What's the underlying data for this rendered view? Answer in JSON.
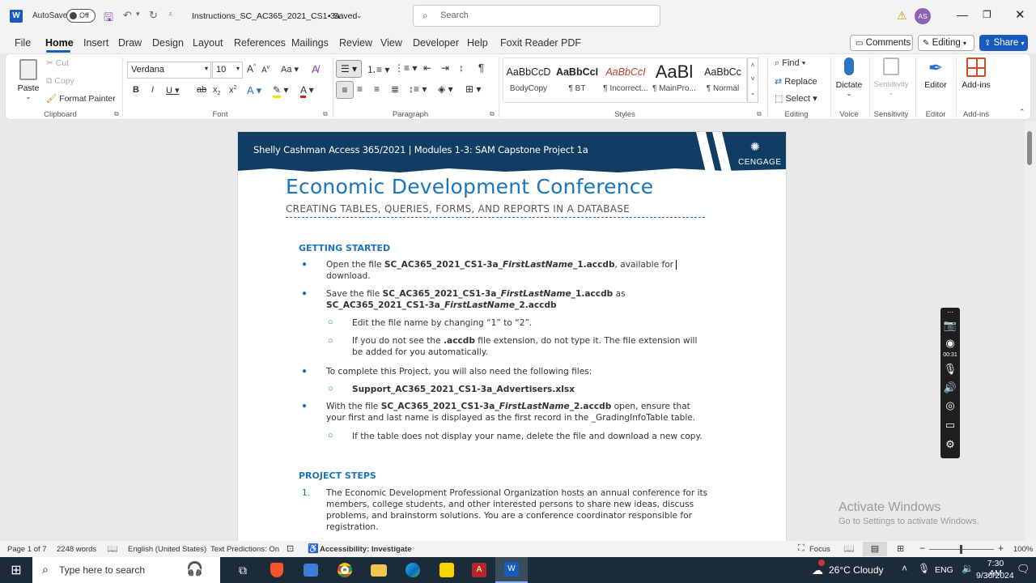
{
  "titlebar": {
    "autosave_label": "AutoSave",
    "autosave_state": "Off",
    "doc_title": "Instructions_SC_AC365_2021_CS1-3a",
    "save_status": "• Saved",
    "search_placeholder": "Search",
    "user_initials": "AS"
  },
  "tabs": [
    "File",
    "Home",
    "Insert",
    "Draw",
    "Design",
    "Layout",
    "References",
    "Mailings",
    "Review",
    "View",
    "Developer",
    "Help",
    "Foxit Reader PDF"
  ],
  "tabs_right": {
    "comments": "Comments",
    "editing": "Editing",
    "share": "Share"
  },
  "ribbon": {
    "clipboard": {
      "paste": "Paste",
      "cut": "Cut",
      "copy": "Copy",
      "format_painter": "Format Painter",
      "label": "Clipboard"
    },
    "font": {
      "name": "Verdana",
      "size": "10",
      "label": "Font"
    },
    "paragraph": {
      "label": "Paragraph"
    },
    "styles": {
      "label": "Styles",
      "items": [
        {
          "preview": "AaBbCcD",
          "name": "BodyCopy"
        },
        {
          "preview": "AaBbCcI",
          "name": "¶ BT"
        },
        {
          "preview": "AaBbCcI",
          "name": "¶ Incorrect..."
        },
        {
          "preview": "AaBl",
          "name": "¶ MainPro..."
        },
        {
          "preview": "AaBbCc",
          "name": "¶ Normal"
        }
      ]
    },
    "editing": {
      "find": "Find",
      "replace": "Replace",
      "select": "Select",
      "label": "Editing"
    },
    "voice": {
      "dictate": "Dictate",
      "label": "Voice"
    },
    "sensitivity": {
      "button": "Sensitivity",
      "label": "Sensitivity"
    },
    "editor": {
      "button": "Editor",
      "label": "Editor"
    },
    "addins": {
      "button": "Add-ins",
      "label": "Add-ins"
    }
  },
  "document": {
    "banner_text": "Shelly Cashman Access 365/2021 | Modules 1-3: SAM Capstone Project 1a",
    "brand": "CENGAGE",
    "title": "Economic Development Conference",
    "subtitle": "CREATING TABLES, QUERIES, FORMS, AND REPORTS IN A DATABASE",
    "getting_started": "GETTING STARTED",
    "b1_pre": "Open the file ",
    "b1_file": "SC_AC365_2021_CS1-3a_",
    "b1_name": "FirstLastName",
    "b1_ext": "_1.accdb",
    "b1_post": ", available for",
    "b1_line2": "download.",
    "b2_pre": "Save the file ",
    "b2_file": "SC_AC365_2021_CS1-3a_",
    "b2_name": "FirstLastName",
    "b2_ext": "_1.accdb",
    "b2_as": " as",
    "b2_file2": "SC_AC365_2021_CS1-3a_",
    "b2_name2": "FirstLastName",
    "b2_ext2": "_2.accdb",
    "s1": "Edit the file name by changing “1” to “2”.",
    "s2_pre": "If you do not see the ",
    "s2_bold": ".accdb",
    "s2_post": " file extension, do not type it. The file extension will",
    "s2_line2": "be added for you automatically.",
    "b3": "To complete this Project, you will also need the following files:",
    "s3": "Support_AC365_2021_CS1-3a_Advertisers.xlsx",
    "b4_pre": "With the file ",
    "b4_file": "SC_AC365_2021_CS1-3a_",
    "b4_name": "FirstLastName",
    "b4_ext": "_2.accdb",
    "b4_post": " open, ensure that",
    "b4_line2": "your first and last name is displayed as the first record in the _GradingInfoTable table.",
    "s4": "If the table does not display your name, delete the file and download a new copy.",
    "project_steps": "PROJECT STEPS",
    "step1_num": "1.",
    "step1_l1": "The Economic Development Professional Organization hosts an annual conference for its",
    "step1_l2": "members, college students, and other interested persons to share new ideas, discuss",
    "step1_l3": "problems, and brainstorm solutions. You are a conference coordinator responsible for",
    "step1_l4": "registration."
  },
  "recorder": {
    "timer": "00:31"
  },
  "watermark": {
    "title": "Activate Windows",
    "sub": "Go to Settings to activate Windows."
  },
  "statusbar": {
    "page": "Page 1 of 7",
    "words": "2248 words",
    "language": "English (United States)",
    "predictions": "Text Predictions: On",
    "accessibility": "Accessibility: Investigate",
    "focus": "Focus",
    "zoom": "100%"
  },
  "taskbar": {
    "search_placeholder": "Type here to search",
    "weather": "26°C  Cloudy",
    "lang": "ENG",
    "time": "7:30 AM",
    "date": "9/30/2024"
  },
  "colors": {
    "accent": "#185abd",
    "banner": "#0f3d64",
    "heading": "#1b75bb",
    "taskbar": "#1b2b3a"
  }
}
